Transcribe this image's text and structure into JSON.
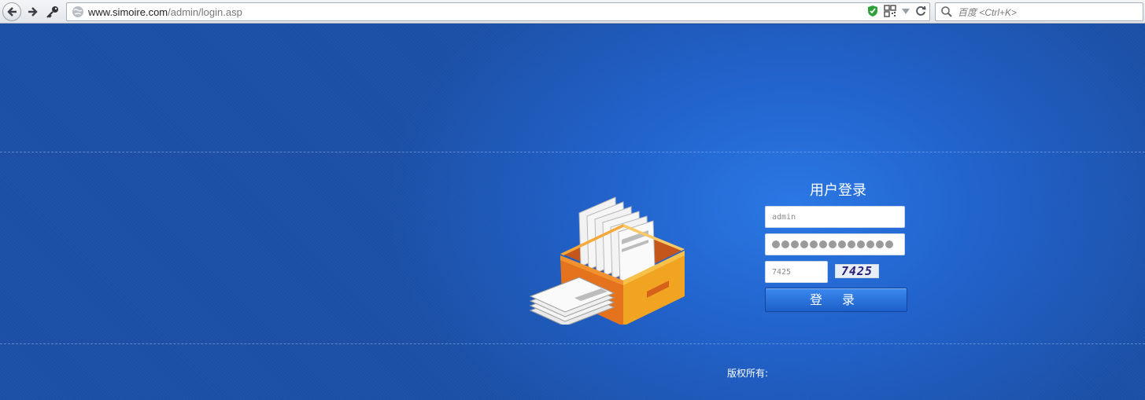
{
  "browser": {
    "url_domain": "www.simoire.com",
    "url_path": "/admin/login.asp",
    "search_placeholder": "百度 <Ctrl+K>"
  },
  "login": {
    "title": "用户登录",
    "username_value": "admin",
    "password_mask_count": 13,
    "code_value": "7425",
    "captcha_text": "7425",
    "submit_label": "登 录"
  },
  "footer": {
    "copyright": "版权所有:"
  },
  "colors": {
    "page_bg": "#1b4fa6",
    "button_top": "#3b8af0",
    "button_bottom": "#1e5fc9"
  }
}
